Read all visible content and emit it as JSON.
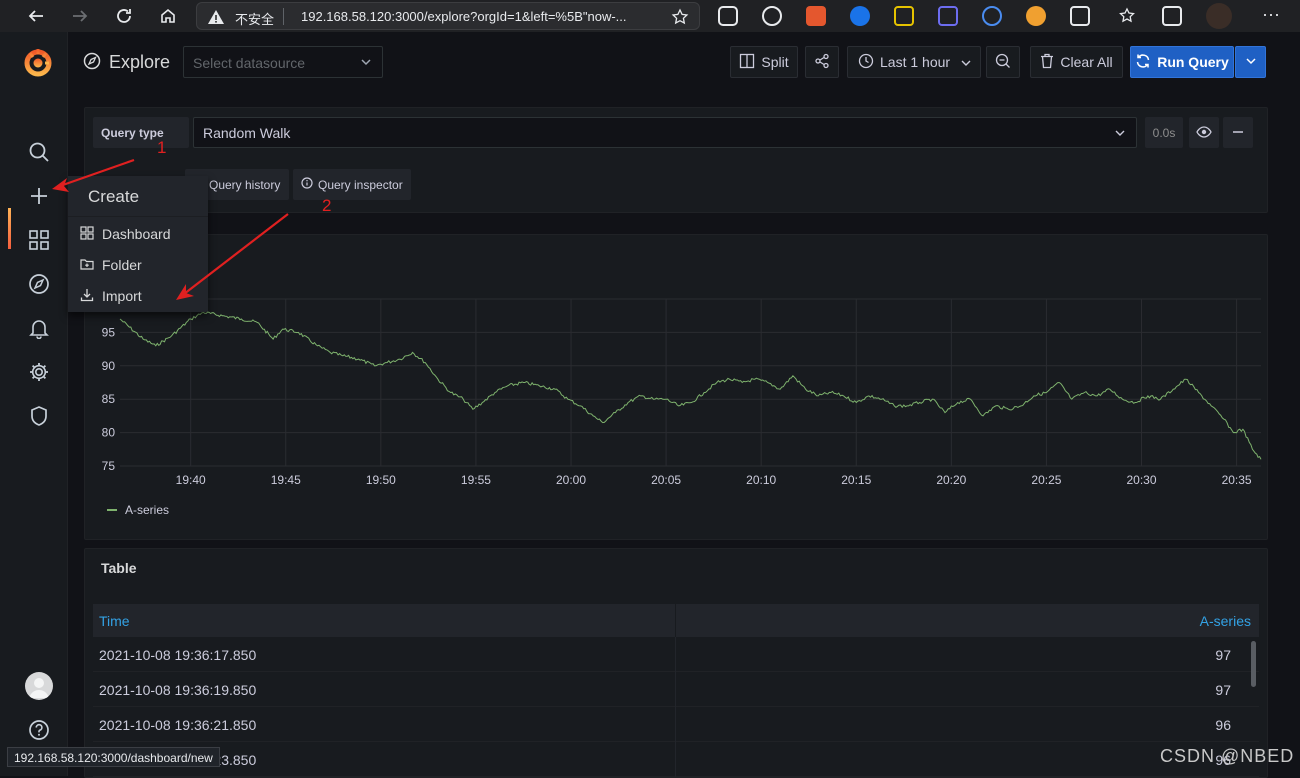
{
  "browser": {
    "insecure_label": "不安全",
    "url": "192.168.58.120:3000/explore?orgId=1&left=%5B\"now-...",
    "status_url": "192.168.58.120:3000/dashboard/new"
  },
  "header": {
    "title": "Explore",
    "datasource_placeholder": "Select datasource",
    "split_label": "Split",
    "time_range": "Last 1 hour",
    "clear_all": "Clear All",
    "run_query": "Run Query"
  },
  "query": {
    "type_label": "Query type",
    "type_value": "Random Walk",
    "duration": "0.0s",
    "history_label": "Query history",
    "inspector_label": "Query inspector"
  },
  "create_menu": {
    "title": "Create",
    "items": [
      {
        "label": "Dashboard",
        "icon": "apps-icon"
      },
      {
        "label": "Folder",
        "icon": "folder-plus-icon"
      },
      {
        "label": "Import",
        "icon": "import-icon"
      }
    ]
  },
  "annotations": {
    "one": "1",
    "two": "2"
  },
  "chart_data": {
    "type": "line",
    "x_ticks": [
      "19:40",
      "19:45",
      "19:50",
      "19:55",
      "20:00",
      "20:05",
      "20:10",
      "20:15",
      "20:20",
      "20:25",
      "20:30",
      "20:35"
    ],
    "y_ticks": [
      "75",
      "80",
      "85",
      "90",
      "95"
    ],
    "ylim": [
      75,
      100
    ],
    "xlim": [
      "19:36:17",
      "20:36:17"
    ],
    "series": [
      {
        "name": "A-series",
        "color": "#7eb26d",
        "points": [
          [
            "19:36:17",
            97
          ],
          [
            "19:37:30",
            94
          ],
          [
            "19:38:10",
            93
          ],
          [
            "19:39:00",
            94.5
          ],
          [
            "19:40:00",
            97
          ],
          [
            "19:40:40",
            98
          ],
          [
            "19:41:40",
            97.5
          ],
          [
            "19:42:40",
            97
          ],
          [
            "19:43:30",
            96.5
          ],
          [
            "19:44:20",
            94
          ],
          [
            "19:44:50",
            95.5
          ],
          [
            "19:45:40",
            95
          ],
          [
            "19:46:40",
            93
          ],
          [
            "19:47:20",
            92
          ],
          [
            "19:48:00",
            91.5
          ],
          [
            "19:48:50",
            91
          ],
          [
            "19:49:40",
            90
          ],
          [
            "19:50:20",
            90.5
          ],
          [
            "19:51:00",
            91
          ],
          [
            "19:51:40",
            92
          ],
          [
            "19:52:20",
            90.5
          ],
          [
            "19:53:00",
            88
          ],
          [
            "19:53:40",
            86
          ],
          [
            "19:54:20",
            85
          ],
          [
            "19:54:50",
            83.5
          ],
          [
            "19:55:20",
            84.5
          ],
          [
            "19:56:00",
            86
          ],
          [
            "19:56:40",
            87
          ],
          [
            "19:57:30",
            87.5
          ],
          [
            "19:58:20",
            87
          ],
          [
            "19:59:10",
            86.5
          ],
          [
            "19:59:50",
            85
          ],
          [
            "20:00:30",
            84
          ],
          [
            "20:01:10",
            82.5
          ],
          [
            "20:01:40",
            81.5
          ],
          [
            "20:02:20",
            83
          ],
          [
            "20:03:00",
            84.5
          ],
          [
            "20:03:40",
            85.5
          ],
          [
            "20:04:20",
            85
          ],
          [
            "20:05:00",
            85
          ],
          [
            "20:05:40",
            84
          ],
          [
            "20:06:20",
            84.5
          ],
          [
            "20:07:00",
            86
          ],
          [
            "20:07:40",
            87.5
          ],
          [
            "20:08:20",
            88
          ],
          [
            "20:09:00",
            87.5
          ],
          [
            "20:09:40",
            88
          ],
          [
            "20:10:20",
            87.5
          ],
          [
            "20:11:00",
            86.5
          ],
          [
            "20:11:40",
            88.5
          ],
          [
            "20:12:20",
            86.5
          ],
          [
            "20:13:00",
            85.5
          ],
          [
            "20:13:40",
            86
          ],
          [
            "20:14:20",
            85.5
          ],
          [
            "20:15:00",
            84.5
          ],
          [
            "20:15:40",
            85.5
          ],
          [
            "20:16:20",
            85
          ],
          [
            "20:17:00",
            84
          ],
          [
            "20:17:40",
            84
          ],
          [
            "20:18:20",
            84.5
          ],
          [
            "20:19:00",
            85
          ],
          [
            "20:19:40",
            83
          ],
          [
            "20:20:20",
            84.5
          ],
          [
            "20:21:00",
            85
          ],
          [
            "20:21:40",
            82.5
          ],
          [
            "20:22:20",
            84
          ],
          [
            "20:23:00",
            83.5
          ],
          [
            "20:23:40",
            84
          ],
          [
            "20:24:20",
            85.5
          ],
          [
            "20:25:00",
            86
          ],
          [
            "20:25:40",
            87.5
          ],
          [
            "20:26:20",
            85
          ],
          [
            "20:27:00",
            86
          ],
          [
            "20:27:40",
            85.5
          ],
          [
            "20:28:20",
            86.5
          ],
          [
            "20:29:00",
            85
          ],
          [
            "20:29:40",
            84.5
          ],
          [
            "20:30:20",
            85.5
          ],
          [
            "20:31:00",
            85
          ],
          [
            "20:31:40",
            86.5
          ],
          [
            "20:32:20",
            88
          ],
          [
            "20:33:00",
            86
          ],
          [
            "20:33:40",
            84
          ],
          [
            "20:34:20",
            82
          ],
          [
            "20:34:50",
            80
          ],
          [
            "20:35:20",
            80.5
          ],
          [
            "20:35:50",
            77.5
          ],
          [
            "20:36:17",
            76
          ]
        ]
      }
    ]
  },
  "legend": {
    "series_name": "A-series"
  },
  "table": {
    "title": "Table",
    "columns": [
      "Time",
      "A-series"
    ],
    "rows": [
      [
        "2021-10-08 19:36:17.850",
        "97"
      ],
      [
        "2021-10-08 19:36:19.850",
        "97"
      ],
      [
        "2021-10-08 19:36:21.850",
        "96"
      ],
      [
        "2021-10-08 19:36:23.850",
        "96"
      ]
    ]
  },
  "watermark": "CSDN @NBED",
  "colors": {
    "accent": "#3274d9",
    "orange": "#f8941d",
    "arrow": "#e02020",
    "series": "#7eb26d"
  }
}
